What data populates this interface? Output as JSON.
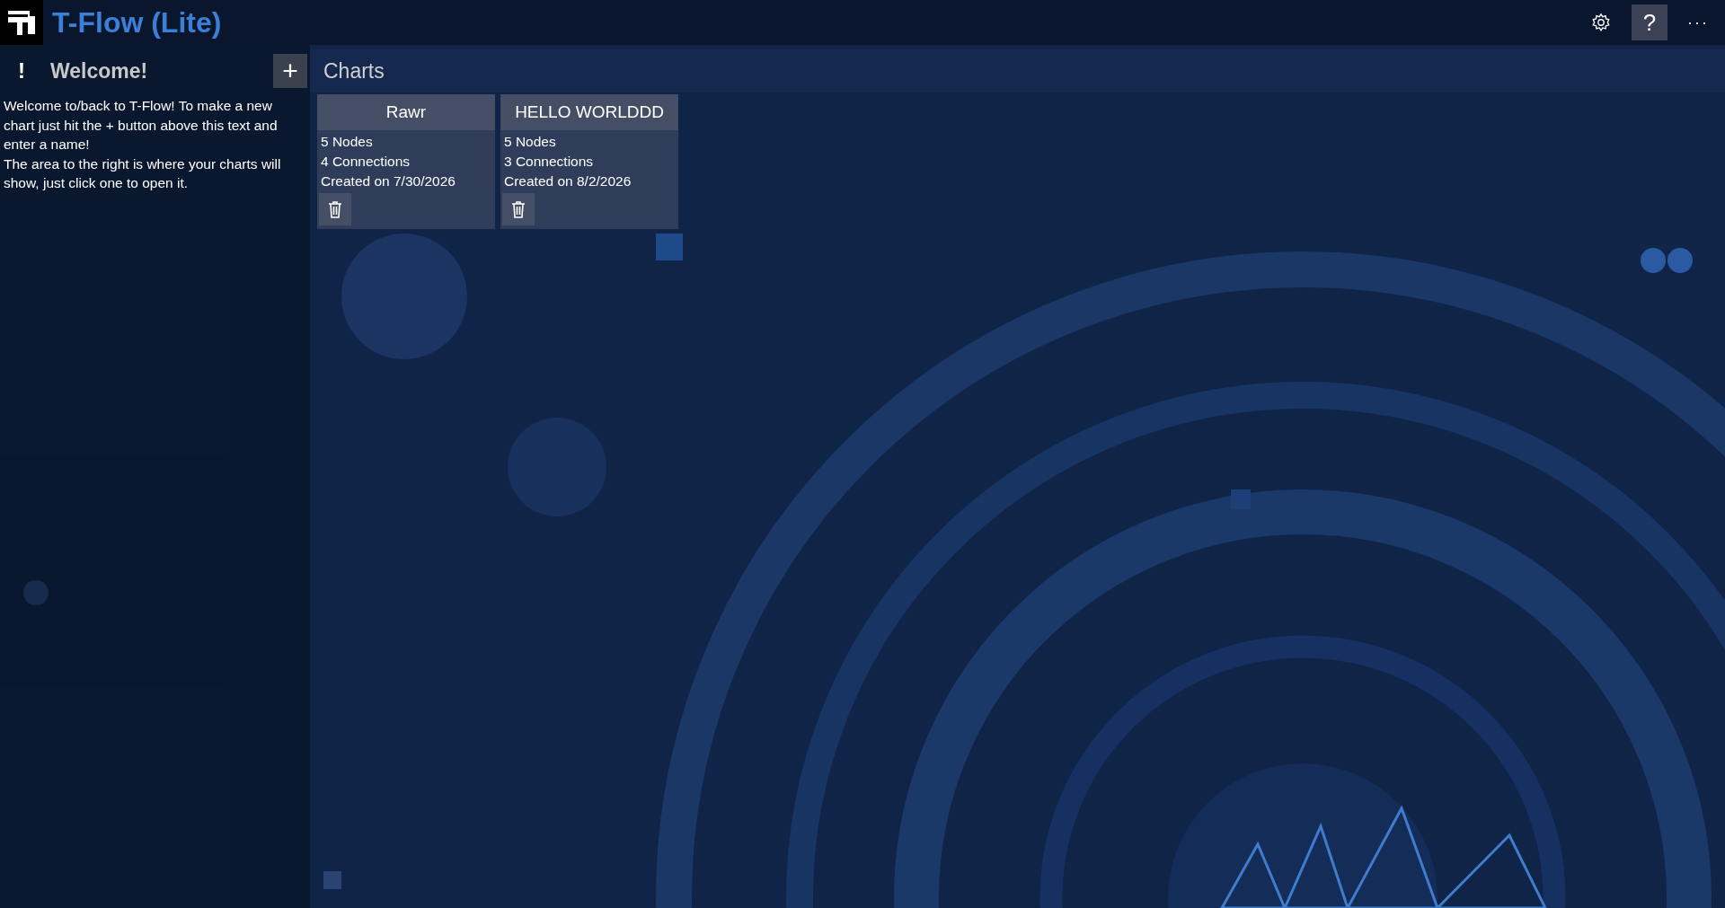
{
  "app": {
    "title": "T-Flow (Lite)"
  },
  "toolbar": [
    {
      "kind": "settings",
      "highlighted": false
    },
    {
      "kind": "help",
      "label": "?",
      "highlighted": true
    },
    {
      "kind": "more",
      "label": "···",
      "highlighted": false
    }
  ],
  "welcome_panel": {
    "icon_text": "!",
    "title": "Welcome!",
    "add_label": "+",
    "paragraphs": [
      "Welcome to/back to T-Flow! To make a new chart just hit the + button above this text and enter a name!",
      "The area to the right is where your charts will show, just click one to open it."
    ]
  },
  "charts_panel": {
    "title": "Charts",
    "charts": [
      {
        "name": "Rawr",
        "nodes": "5 Nodes",
        "connections": "4 Connections",
        "created": "Created on 7/30/2026"
      },
      {
        "name": "HELLO WORLDDD",
        "nodes": "5 Nodes",
        "connections": "3 Connections",
        "created": "Created on 8/2/2026"
      }
    ]
  }
}
